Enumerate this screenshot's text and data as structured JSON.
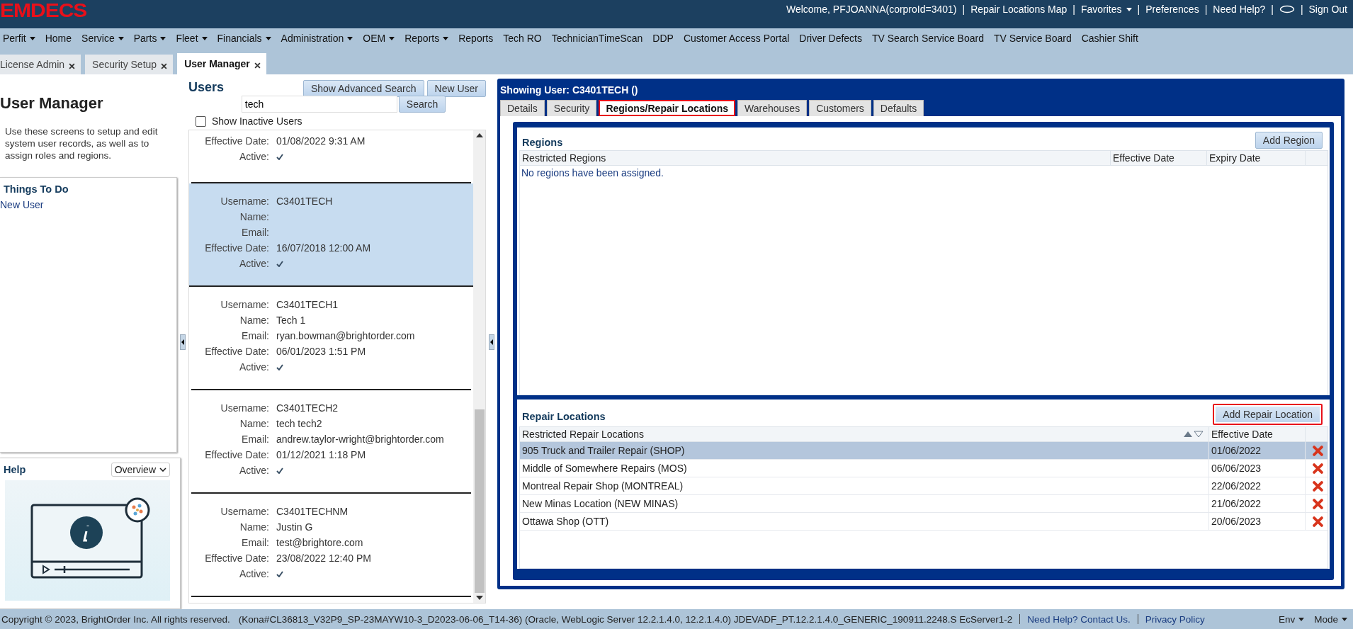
{
  "header": {
    "logo": "EMDECS",
    "links": [
      {
        "kind": "text",
        "label": "Welcome, PFJOANNA(corproId=3401)"
      },
      {
        "kind": "sep",
        "label": "|"
      },
      {
        "kind": "link",
        "label": "Repair Locations Map"
      },
      {
        "kind": "sep",
        "label": "|"
      },
      {
        "kind": "menu",
        "label": "Favorites"
      },
      {
        "kind": "sep",
        "label": "|"
      },
      {
        "kind": "link",
        "label": "Preferences"
      },
      {
        "kind": "sep",
        "label": "|"
      },
      {
        "kind": "link",
        "label": "Need Help?"
      },
      {
        "kind": "sep",
        "label": "|"
      },
      {
        "kind": "icon"
      },
      {
        "kind": "sep",
        "label": "|"
      },
      {
        "kind": "link",
        "label": "Sign Out"
      }
    ]
  },
  "menu": [
    {
      "label": "Perfit",
      "dropdown": true
    },
    {
      "label": "Home",
      "dropdown": false
    },
    {
      "label": "Service",
      "dropdown": true
    },
    {
      "label": "Parts",
      "dropdown": true
    },
    {
      "label": "Fleet",
      "dropdown": true
    },
    {
      "label": "Financials",
      "dropdown": true
    },
    {
      "label": "Administration",
      "dropdown": true
    },
    {
      "label": "OEM",
      "dropdown": true
    },
    {
      "label": "Reports",
      "dropdown": true
    },
    {
      "label": "Reports",
      "dropdown": false
    },
    {
      "label": "Tech RO",
      "dropdown": false
    },
    {
      "label": "TechnicianTimeScan",
      "dropdown": false
    },
    {
      "label": "DDP",
      "dropdown": false
    },
    {
      "label": "Customer Access Portal",
      "dropdown": false
    },
    {
      "label": "Driver Defects",
      "dropdown": false
    },
    {
      "label": "TV Search Service Board",
      "dropdown": false
    },
    {
      "label": "TV Service Board",
      "dropdown": false
    },
    {
      "label": "Cashier Shift",
      "dropdown": false
    }
  ],
  "tabs": [
    {
      "label": "License Admin",
      "selected": false
    },
    {
      "label": "Security Setup",
      "selected": false
    },
    {
      "label": "User Manager",
      "selected": true
    }
  ],
  "left_panel": {
    "title": "User Manager",
    "description": "Use these screens to setup and edit system user records, as well as to assign roles and regions.",
    "things_to_do": {
      "title": "Things To Do",
      "links": [
        "New User"
      ]
    },
    "help": {
      "title": "Help",
      "select": "Overview"
    }
  },
  "users": {
    "title": "Users",
    "buttons": [
      "Show Advanced Search",
      "New User"
    ],
    "search": {
      "value": "tech",
      "button": "Search"
    },
    "show_inactive": {
      "label": "Show Inactive Users",
      "checked": false
    },
    "list": [
      {
        "selected": false,
        "fields": [
          {
            "kind": "text",
            "label": "Effective Date:",
            "value": "01/08/2022 9:31 AM"
          },
          {
            "kind": "check",
            "label": "Active:",
            "checked": true
          }
        ]
      },
      {
        "selected": true,
        "fields": [
          {
            "kind": "text",
            "label": "Username:",
            "value": "C3401TECH"
          },
          {
            "kind": "text",
            "label": "Name:"
          },
          {
            "kind": "text",
            "label": "Email:"
          },
          {
            "kind": "text",
            "label": "Effective Date:",
            "value": "16/07/2018 12:00 AM"
          },
          {
            "kind": "check",
            "label": "Active:",
            "checked": true
          }
        ]
      },
      {
        "selected": false,
        "fields": [
          {
            "kind": "text",
            "label": "Username:",
            "value": "C3401TECH1"
          },
          {
            "kind": "text",
            "label": "Name:",
            "value": "Tech 1"
          },
          {
            "kind": "text",
            "label": "Email:",
            "value": "ryan.bowman@brightorder.com"
          },
          {
            "kind": "text",
            "label": "Effective Date:",
            "value": "06/01/2023 1:51 PM"
          },
          {
            "kind": "check",
            "label": "Active:",
            "checked": true
          }
        ]
      },
      {
        "selected": false,
        "fields": [
          {
            "kind": "text",
            "label": "Username:",
            "value": "C3401TECH2"
          },
          {
            "kind": "text",
            "label": "Name:",
            "value": "tech tech2"
          },
          {
            "kind": "text",
            "label": "Email:",
            "value": "andrew.taylor-wright@brightorder.com"
          },
          {
            "kind": "text",
            "label": "Effective Date:",
            "value": "01/12/2021 1:18 PM"
          },
          {
            "kind": "check",
            "label": "Active:",
            "checked": true
          }
        ]
      },
      {
        "selected": false,
        "fields": [
          {
            "kind": "text",
            "label": "Username:",
            "value": "C3401TECHNM"
          },
          {
            "kind": "text",
            "label": "Name:",
            "value": "Justin G"
          },
          {
            "kind": "text",
            "label": "Email:",
            "value": "test@brightore.com"
          },
          {
            "kind": "text",
            "label": "Effective Date:",
            "value": "23/08/2022 12:40 PM"
          },
          {
            "kind": "check",
            "label": "Active:",
            "checked": true
          }
        ]
      }
    ]
  },
  "detail": {
    "title": "Showing User: C3401TECH ()",
    "tabs": [
      {
        "label": "Details",
        "selected": false,
        "annotated": false
      },
      {
        "label": "Security",
        "selected": false,
        "annotated": false
      },
      {
        "label": "Regions/Repair Locations",
        "selected": true,
        "annotated": true
      },
      {
        "label": "Warehouses",
        "selected": false,
        "annotated": false
      },
      {
        "label": "Customers",
        "selected": false,
        "annotated": false
      },
      {
        "label": "Defaults",
        "selected": false,
        "annotated": false
      }
    ],
    "regions": {
      "title": "Regions",
      "button": {
        "label": "Add Region",
        "annotated": false
      },
      "columns": [
        "Restricted Regions",
        "Effective Date",
        "Expiry Date"
      ],
      "empty_message": "No regions have been assigned."
    },
    "repair_locations": {
      "title": "Repair Locations",
      "button": {
        "label": "Add Repair Location",
        "annotated": true
      },
      "columns": [
        "Restricted Repair Locations",
        "Effective Date"
      ],
      "rows": [
        {
          "name": "905 Truck and Trailer Repair (SHOP)",
          "date": "01/06/2022",
          "selected": true
        },
        {
          "name": "Middle of Somewhere Repairs (MOS)",
          "date": "06/06/2023",
          "selected": false
        },
        {
          "name": "Montreal Repair Shop (MONTREAL)",
          "date": "22/06/2022",
          "selected": false
        },
        {
          "name": "New Minas Location (NEW MINAS)",
          "date": "21/06/2022",
          "selected": false
        },
        {
          "name": "Ottawa Shop (OTT)",
          "date": "20/06/2023",
          "selected": false
        }
      ]
    }
  },
  "footer": {
    "copyright": "Copyright © 2023, BrightOrder Inc. All rights reserved.",
    "version": "(Kona#CL36813_V32P9_SP-23MAYW10-3_D2023-06-06_T14-36) (Oracle, WebLogic Server 12.2.1.4.0, 12.2.1.4.0) JDEVADF_PT.12.2.1.4.0_GENERIC_190911.2248.S EcServer1-2",
    "links": [
      "Need Help? Contact Us.",
      "Privacy Policy"
    ],
    "menus": [
      "Env",
      "Mode"
    ]
  }
}
